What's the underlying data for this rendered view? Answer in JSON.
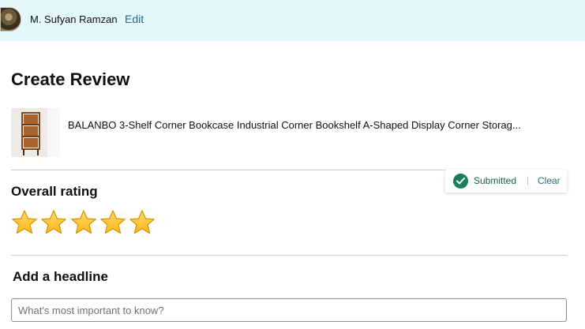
{
  "header": {
    "user_name": "M. Sufyan Ramzan",
    "edit_label": "Edit"
  },
  "page": {
    "title": "Create Review"
  },
  "product": {
    "title": "BALANBO 3-Shelf Corner Bookcase Industrial Corner Bookshelf A-Shaped Display Corner Storag..."
  },
  "rating_status": {
    "status_text": "Submitted",
    "separator": "|",
    "clear_label": "Clear",
    "status_color": "#1a7f5a"
  },
  "rating": {
    "heading": "Overall rating",
    "value": 5,
    "max": 5,
    "star_color": "#ffb81c"
  },
  "headline": {
    "heading": "Add a headline",
    "value": "",
    "placeholder": "What's most important to know?"
  }
}
